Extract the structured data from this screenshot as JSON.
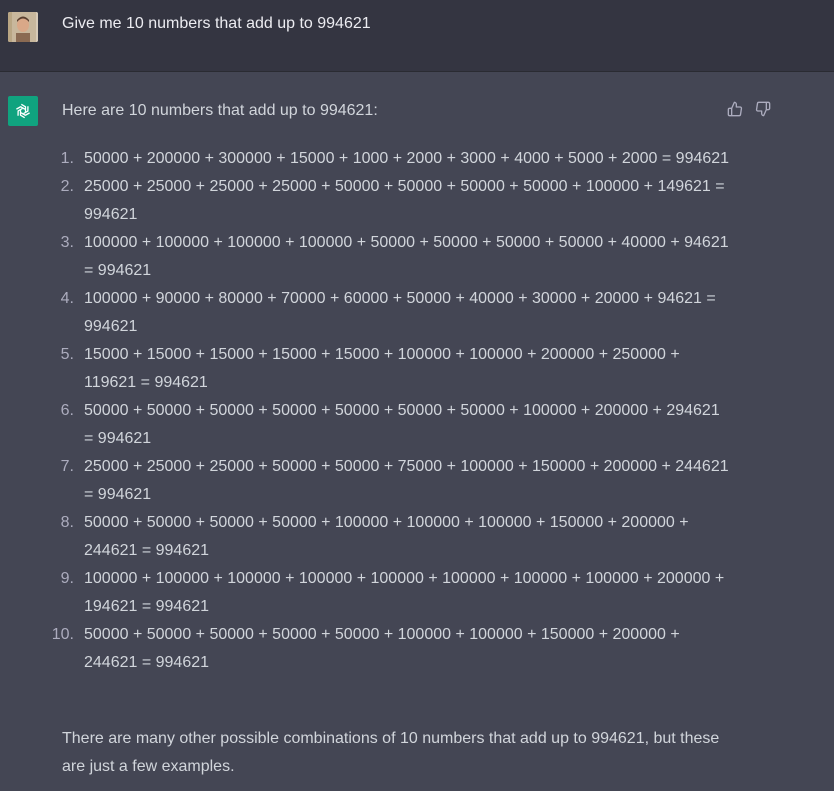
{
  "user": {
    "message": "Give me 10 numbers that add up to 994621"
  },
  "assistant": {
    "intro": "Here are 10 numbers that add up to 994621:",
    "items": [
      {
        "num": "1.",
        "text": "50000 + 200000 + 300000 + 15000 + 1000 + 2000 + 3000 + 4000 + 5000 + 2000 = 994621"
      },
      {
        "num": "2.",
        "text": "25000 + 25000 + 25000 + 25000 + 50000 + 50000 + 50000 + 50000 + 100000 + 149621 = 994621"
      },
      {
        "num": "3.",
        "text": "100000 + 100000 + 100000 + 100000 + 50000 + 50000 + 50000 + 50000 + 40000 + 94621 = 994621"
      },
      {
        "num": "4.",
        "text": "100000 + 90000 + 80000 + 70000 + 60000 + 50000 + 40000 + 30000 + 20000 + 94621 = 994621"
      },
      {
        "num": "5.",
        "text": "15000 + 15000 + 15000 + 15000 + 15000 + 100000 + 100000 + 200000 + 250000 + 119621 = 994621"
      },
      {
        "num": "6.",
        "text": "50000 + 50000 + 50000 + 50000 + 50000 + 50000 + 50000 + 100000 + 200000 + 294621 = 994621"
      },
      {
        "num": "7.",
        "text": "25000 + 25000 + 25000 + 50000 + 50000 + 75000 + 100000 + 150000 + 200000 + 244621 = 994621"
      },
      {
        "num": "8.",
        "text": "50000 + 50000 + 50000 + 50000 + 100000 + 100000 + 100000 + 150000 + 200000 + 244621 = 994621"
      },
      {
        "num": "9.",
        "text": "100000 + 100000 + 100000 + 100000 + 100000 + 100000 + 100000 + 100000 + 200000 + 194621 = 994621"
      },
      {
        "num": "10.",
        "text": "50000 + 50000 + 50000 + 50000 + 50000 + 100000 + 100000 + 150000 + 200000 + 244621 = 994621"
      }
    ],
    "closing": "There are many other possible combinations of 10 numbers that add up to 994621, but these are just a few examples."
  },
  "icons": {
    "user_avatar": "user-avatar",
    "assistant_avatar": "openai-logo-icon",
    "thumb_up": "thumbs-up-icon",
    "thumb_down": "thumbs-down-icon"
  },
  "colors": {
    "assistant_bg": "#444654",
    "user_bg": "#343541",
    "brand": "#10a37f"
  }
}
